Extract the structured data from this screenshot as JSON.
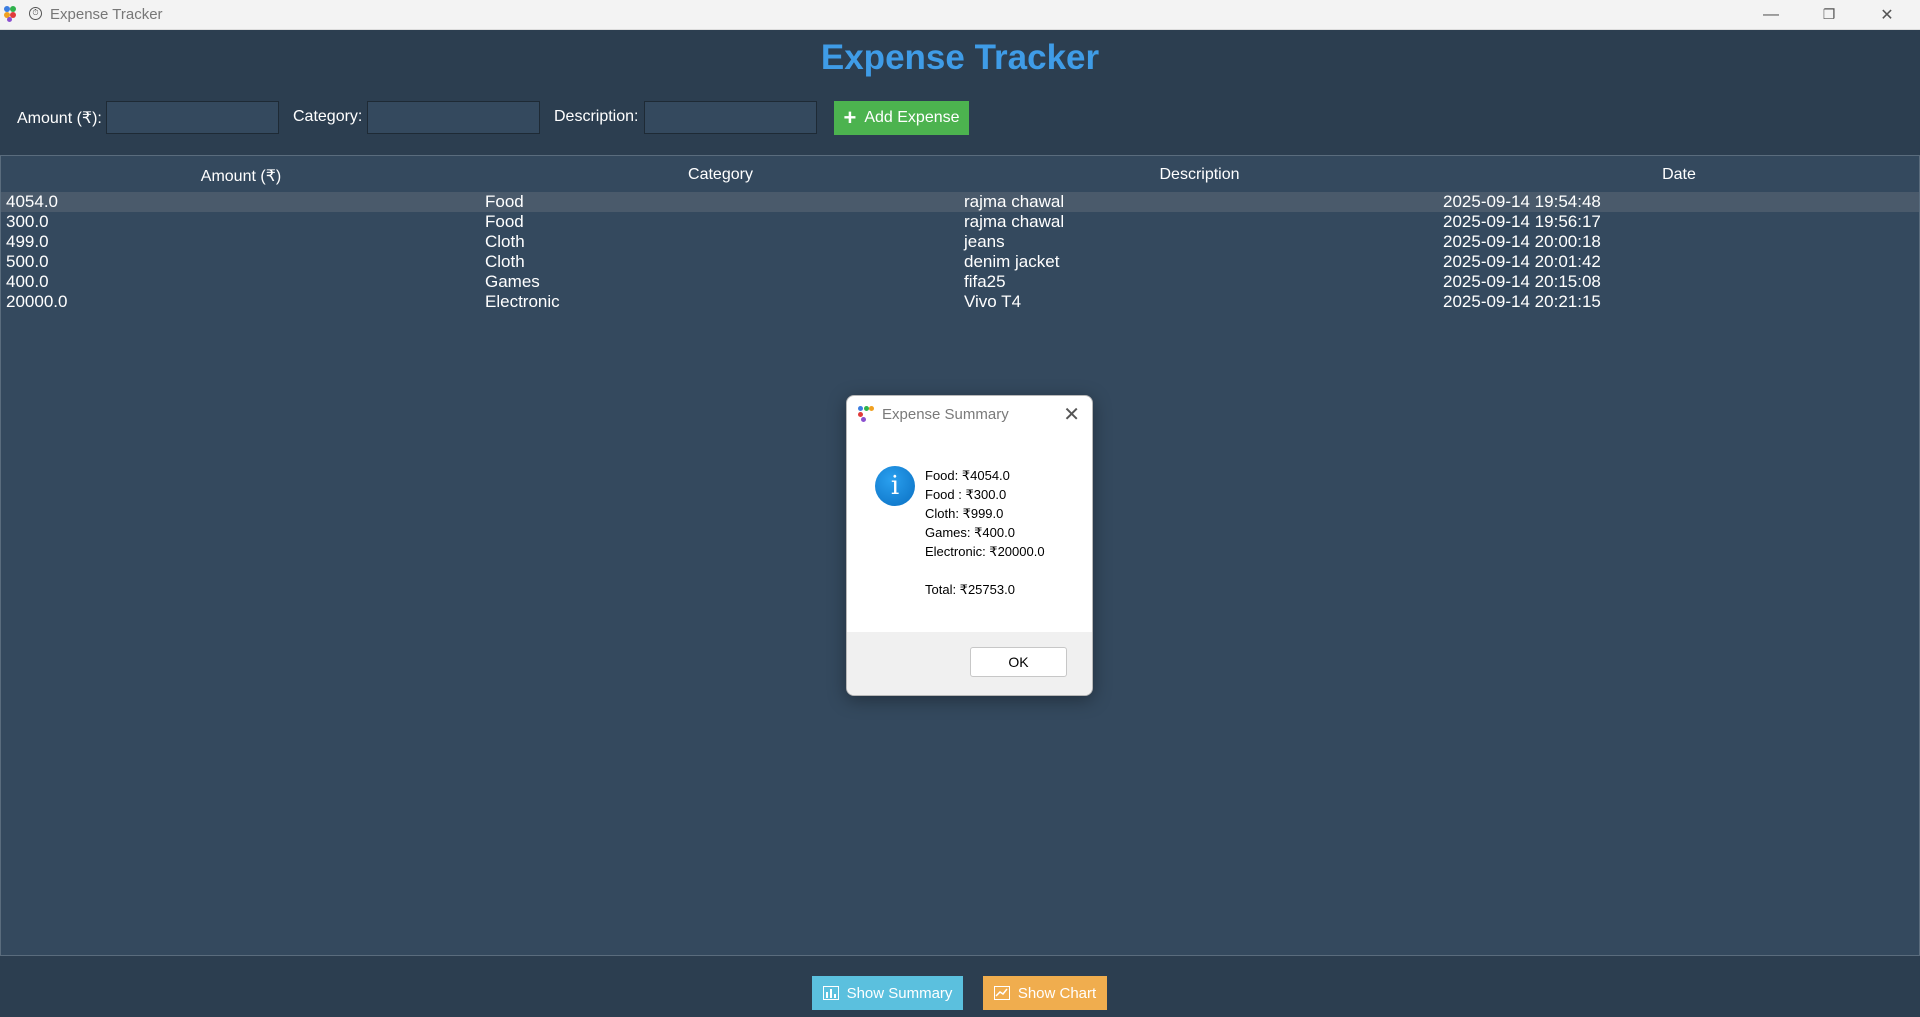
{
  "window": {
    "title": "Expense Tracker",
    "minimize_glyph": "—",
    "restore_glyph": "❐",
    "close_glyph": "✕"
  },
  "header": {
    "title": "Expense Tracker"
  },
  "form": {
    "amount_label": "Amount (₹):",
    "amount_value": "",
    "category_label": "Category:",
    "category_value": "",
    "description_label": "Description:",
    "description_value": "",
    "add_button": "Add Expense",
    "add_icon": "plus-icon"
  },
  "table": {
    "columns": [
      "Amount (₹)",
      "Category",
      "Description",
      "Date"
    ],
    "rows": [
      {
        "amount": "4054.0",
        "category": "Food",
        "description": "rajma chawal",
        "date": "2025-09-14 19:54:48",
        "selected": true
      },
      {
        "amount": "300.0",
        "category": "Food",
        "description": "rajma chawal",
        "date": "2025-09-14 19:56:17"
      },
      {
        "amount": "499.0",
        "category": "Cloth",
        "description": "jeans",
        "date": "2025-09-14 20:00:18"
      },
      {
        "amount": "500.0",
        "category": "Cloth",
        "description": "denim jacket",
        "date": "2025-09-14 20:01:42"
      },
      {
        "amount": "400.0",
        "category": "Games",
        "description": "fifa25",
        "date": "2025-09-14 20:15:08"
      },
      {
        "amount": "20000.0",
        "category": "Electronic",
        "description": "Vivo T4",
        "date": "2025-09-14 20:21:15"
      }
    ]
  },
  "dialog": {
    "title": "Expense Summary",
    "icon": "info-icon",
    "lines": [
      "Food: ₹4054.0",
      "Food : ₹300.0",
      "Cloth: ₹999.0",
      "Games: ₹400.0",
      "Electronic: ₹20000.0"
    ],
    "total": "Total: ₹25753.0",
    "ok_button": "OK"
  },
  "footer": {
    "summary_button": "Show Summary",
    "chart_button": "Show Chart"
  },
  "colors": {
    "background": "#2c3e50",
    "table_background": "#34495e",
    "title": "#3f9ce7",
    "add_button": "#4cb34f",
    "summary_button": "#5bc0de",
    "chart_button": "#f0ad4e"
  }
}
